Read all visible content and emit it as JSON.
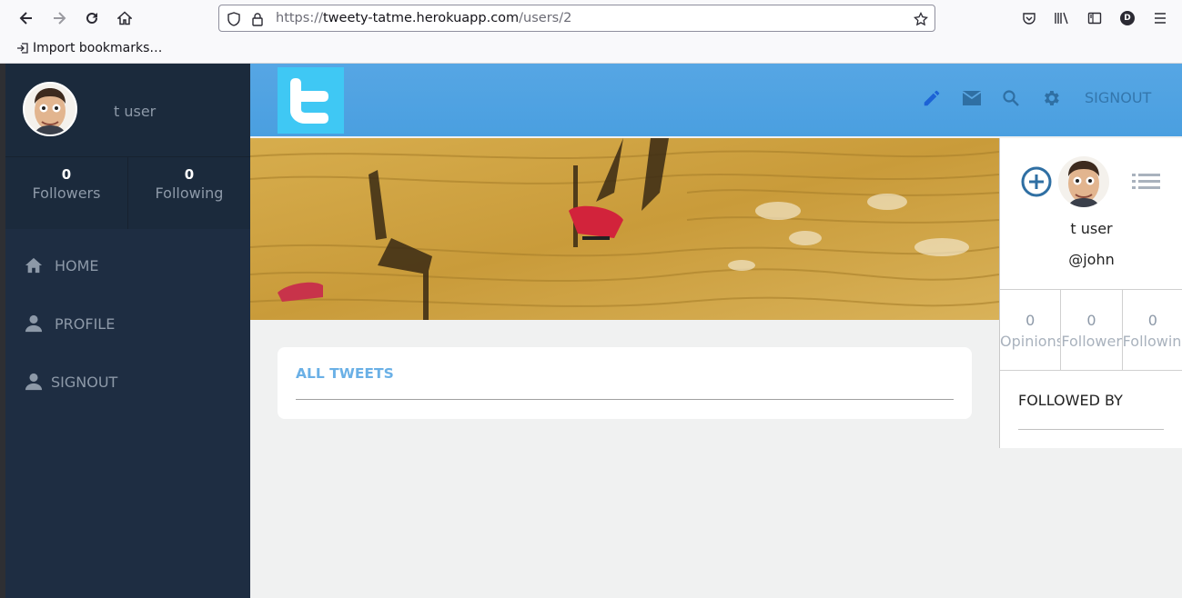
{
  "browser": {
    "url_base": "https://",
    "url_host": "tweety-tatme.herokuapp.com",
    "url_path": "/users/2",
    "bookmark_label": "Import bookmarks…",
    "account_initial": "D"
  },
  "sidebar": {
    "username": "t user",
    "stats": [
      {
        "value": "0",
        "label": "Followers"
      },
      {
        "value": "0",
        "label": "Following"
      }
    ],
    "links": [
      {
        "label": "HOME",
        "icon": "home-icon"
      },
      {
        "label": "PROFILE",
        "icon": "person-icon"
      },
      {
        "label": "SIGNOUT",
        "icon": "person-icon"
      }
    ]
  },
  "appbar": {
    "icons": [
      "pencil-icon",
      "mail-icon",
      "search-icon",
      "gear-icon"
    ],
    "signout_label": "SIGNOUT"
  },
  "main": {
    "tweets_title": "ALL TWEETS"
  },
  "profile": {
    "name": "t user",
    "handle": "@john",
    "stats": [
      {
        "value": "0",
        "label": "Opinions"
      },
      {
        "value": "0",
        "label": "Followers"
      },
      {
        "value": "0",
        "label": "Following"
      }
    ],
    "followed_by_label": "FOLLOWED BY"
  },
  "colors": {
    "sidebar": "#1e2d42",
    "appbar": "#4a9fe0",
    "logo_bg": "#3fc8f4",
    "accent_link": "#6ab0e6"
  }
}
